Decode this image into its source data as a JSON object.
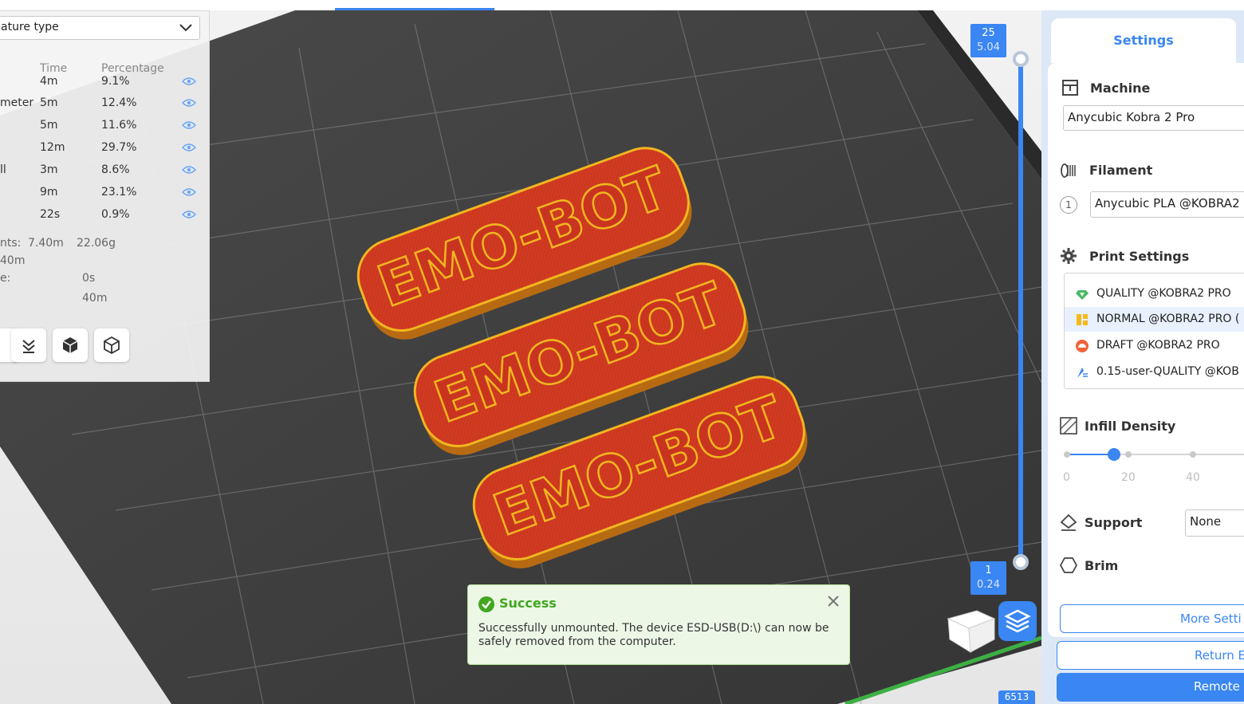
{
  "stats": {
    "feature_type_label": "ature type",
    "col_time": "Time",
    "col_percentage": "Percentage",
    "rows": [
      {
        "label": "",
        "time": "4m",
        "pct": "9.1%"
      },
      {
        "label": "meter",
        "time": "5m",
        "pct": "12.4%"
      },
      {
        "label": "",
        "time": "5m",
        "pct": "11.6%"
      },
      {
        "label": "",
        "time": "12m",
        "pct": "29.7%"
      },
      {
        "label": "ll",
        "time": "3m",
        "pct": "8.6%"
      },
      {
        "label": "",
        "time": "9m",
        "pct": "23.1%"
      },
      {
        "label": "",
        "time": "22s",
        "pct": "0.9%"
      }
    ],
    "filament_label": "nts:",
    "filament_length": "7.40m",
    "filament_weight": "22.06g",
    "total_time": "40m",
    "prepare_label": "e:",
    "prepare_time": "0s",
    "print_time": "40m"
  },
  "scene": {
    "model_text": "EMO-BOT",
    "model_color": "#d13b22",
    "outline_color": "#f1b61f"
  },
  "layer_slider": {
    "top_layer": "25",
    "top_height": "5.04",
    "bottom_layer": "1",
    "bottom_height": "0.24",
    "coord": "6513"
  },
  "toast": {
    "title": "Success",
    "message": "Successfully unmounted. The device ESD-USB(D:\\) can now be safely removed from the computer."
  },
  "settings": {
    "tab": "Settings",
    "machine_title": "Machine",
    "machine_value": "Anycubic Kobra 2 Pro",
    "filament_title": "Filament",
    "filament_index": "1",
    "filament_value": "Anycubic PLA @KOBRA2 P",
    "print_settings_title": "Print Settings",
    "presets": [
      {
        "label": "QUALITY @KOBRA2 PRO",
        "icon": "gem-icon"
      },
      {
        "label": "NORMAL @KOBRA2 PRO (",
        "icon": "normal-icon"
      },
      {
        "label": "DRAFT @KOBRA2 PRO",
        "icon": "draft-icon"
      },
      {
        "label": "0.15-user-QUALITY @KOB",
        "icon": "user-preset-icon"
      }
    ],
    "infill_title": "Infill Density",
    "infill_value": 15,
    "infill_ticks": [
      "0",
      "20",
      "40"
    ],
    "support_title": "Support",
    "support_value": "None",
    "brim_title": "Brim",
    "more_settings": "More Setti",
    "return_label": "Return E",
    "remote_label": "Remote"
  },
  "colors": {
    "accent": "#3a86f2",
    "success": "#43a621",
    "bed": "#3d3d3d"
  }
}
